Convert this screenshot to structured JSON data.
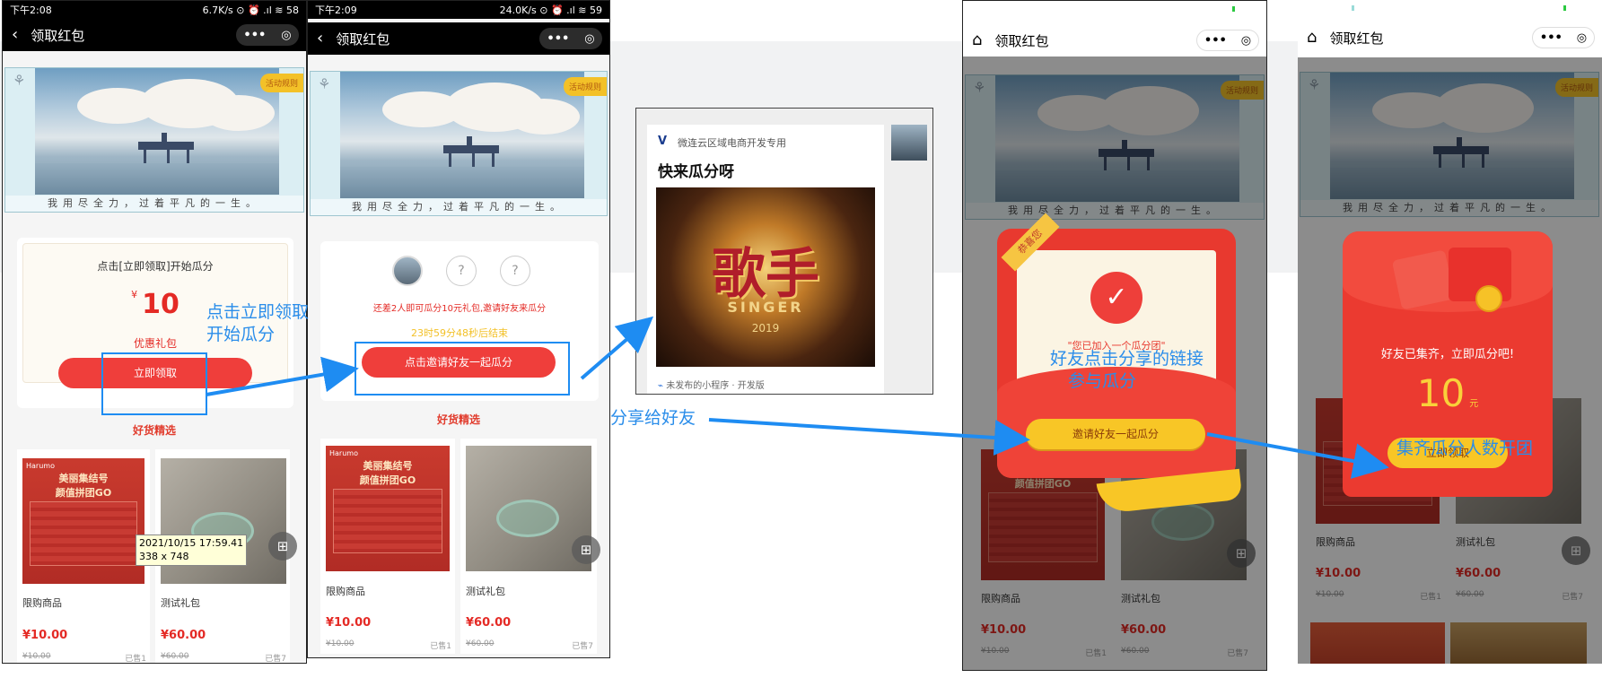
{
  "phone1": {
    "status_left": "下午2:08",
    "status_right": "6.7K/s ⊙ ⏰ .ıl ≋ 58",
    "nav_title": "领取红包",
    "more": "•••",
    "target": "◎",
    "banner_motto": "我用尽全力，过着平凡的一生。",
    "rule_badge": "活动规则",
    "card_hint": "点击[立即领取]开始瓜分",
    "currency": "¥",
    "amount": "10",
    "coupon_label": "优惠礼包",
    "claim_button": "立即领取",
    "section_title": "好货精选",
    "tooltip_line1": "2021/10/15 17:59.41",
    "tooltip_line2": "338 x 748",
    "products": [
      {
        "name": "限购商品",
        "price": "¥10.00",
        "old": "¥10.00",
        "sold": "已售1"
      },
      {
        "name": "测试礼包",
        "price": "¥60.00",
        "old": "¥60.00",
        "sold": "已售7"
      }
    ]
  },
  "phone2": {
    "status_left": "下午2:09",
    "status_right": "24.0K/s ⊙ ⏰ .ıl ≋ 59",
    "nav_title": "领取红包",
    "more": "•••",
    "target": "◎",
    "banner_motto": "我用尽全力，过着平凡的一生。",
    "rule_badge": "活动规则",
    "question": "?",
    "need_text": "还差2人即可瓜分10元礼包,邀请好友来瓜分",
    "countdown": "23时59分48秒后结束",
    "invite_button": "点击邀请好友一起瓜分",
    "section_title": "好货精选",
    "products": [
      {
        "name": "限购商品",
        "price": "¥10.00",
        "old": "¥10.00",
        "sold": "已售1"
      },
      {
        "name": "测试礼包",
        "price": "¥60.00",
        "old": "¥60.00",
        "sold": "已售7"
      }
    ]
  },
  "share": {
    "source": "微连云区域电商开发专用",
    "title": "快来瓜分呀",
    "poster_main": "歌手",
    "poster_sub": "SINGER",
    "poster_year": "2019",
    "footer": "未发布的小程序 · 开发版"
  },
  "phone3": {
    "nav_title": "领取红包",
    "home": "⌂",
    "more": "•••",
    "target": "◎",
    "banner_motto": "我用尽全力，过着平凡的一生。",
    "rule_badge": "活动规则",
    "ribbon": "恭喜您",
    "joined": "\"您已加入一个瓜分团\"",
    "invite_button": "邀请好友一起瓜分",
    "products": [
      {
        "name": "限购商品",
        "price": "¥10.00",
        "old": "¥10.00",
        "sold": "已售1"
      },
      {
        "name": "测试礼包",
        "price": "¥60.00",
        "old": "¥60.00",
        "sold": "已售7"
      }
    ]
  },
  "phone4": {
    "nav_title": "领取红包",
    "home": "⌂",
    "more": "•••",
    "target": "◎",
    "banner_motto": "我用尽全力，过着平凡的一生。",
    "rule_badge": "活动规则",
    "full_text": "好友已集齐，立即瓜分吧!",
    "amount": "10",
    "unit": "元",
    "claim_button": "立即领取",
    "products": [
      {
        "name": "限购商品",
        "price": "¥10.00",
        "old": "¥10.00",
        "sold": "已售1"
      },
      {
        "name": "测试礼包",
        "price": "¥60.00",
        "old": "¥60.00",
        "sold": "已售7"
      }
    ]
  },
  "annotations": {
    "a1_line1": "点击立即领取",
    "a1_line2": "开始瓜分",
    "a2": "分享给好友",
    "a3_line1": "好友点击分享的链接",
    "a3_line2": "参与瓜分",
    "a4": "集齐瓜分人数开团"
  },
  "colors": {
    "accent_red": "#ef3e3b",
    "gold": "#f5c22b",
    "annotation_blue": "#2a8dea"
  }
}
